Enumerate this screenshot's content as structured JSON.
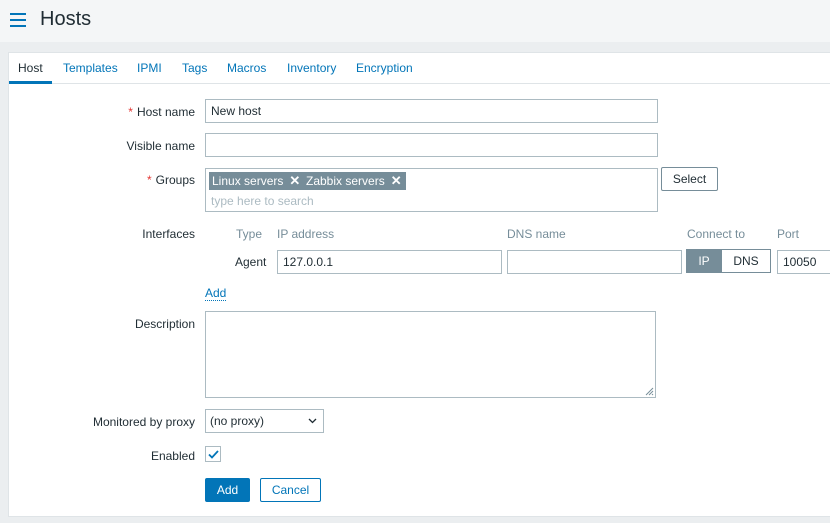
{
  "header": {
    "title": "Hosts"
  },
  "tabs": [
    {
      "label": "Host",
      "active": true
    },
    {
      "label": "Templates"
    },
    {
      "label": "IPMI"
    },
    {
      "label": "Tags"
    },
    {
      "label": "Macros"
    },
    {
      "label": "Inventory"
    },
    {
      "label": "Encryption"
    }
  ],
  "form": {
    "host_name": {
      "label": "Host name",
      "required_mark": "*",
      "value": "New host"
    },
    "visible_name": {
      "label": "Visible name",
      "value": ""
    },
    "groups": {
      "label": "Groups",
      "required_mark": "*",
      "selected": [
        "Linux servers",
        "Zabbix servers"
      ],
      "remove_glyph": "✕",
      "placeholder": "type here to search",
      "select_label": "Select"
    },
    "interfaces": {
      "label": "Interfaces",
      "columns": {
        "type": "Type",
        "ip": "IP address",
        "dns": "DNS name",
        "connect": "Connect to",
        "port": "Port"
      },
      "row": {
        "type": "Agent",
        "ip": "127.0.0.1",
        "dns": "",
        "connect_ip": "IP",
        "connect_dns": "DNS",
        "connect_selected": "IP",
        "port": "10050"
      },
      "add_label": "Add"
    },
    "description": {
      "label": "Description",
      "value": ""
    },
    "proxy": {
      "label": "Monitored by proxy",
      "value": "(no proxy)"
    },
    "enabled": {
      "label": "Enabled",
      "checked": true
    }
  },
  "actions": {
    "add": "Add",
    "cancel": "Cancel"
  },
  "colors": {
    "accent": "#0275b8",
    "required": "#e33734",
    "chip": "#768d99"
  },
  "icons": {
    "menu": "hamburger-icon",
    "remove": "close-icon",
    "dropdown": "chevron-down-icon",
    "check": "check-icon",
    "resize": "resize-grip-icon"
  }
}
